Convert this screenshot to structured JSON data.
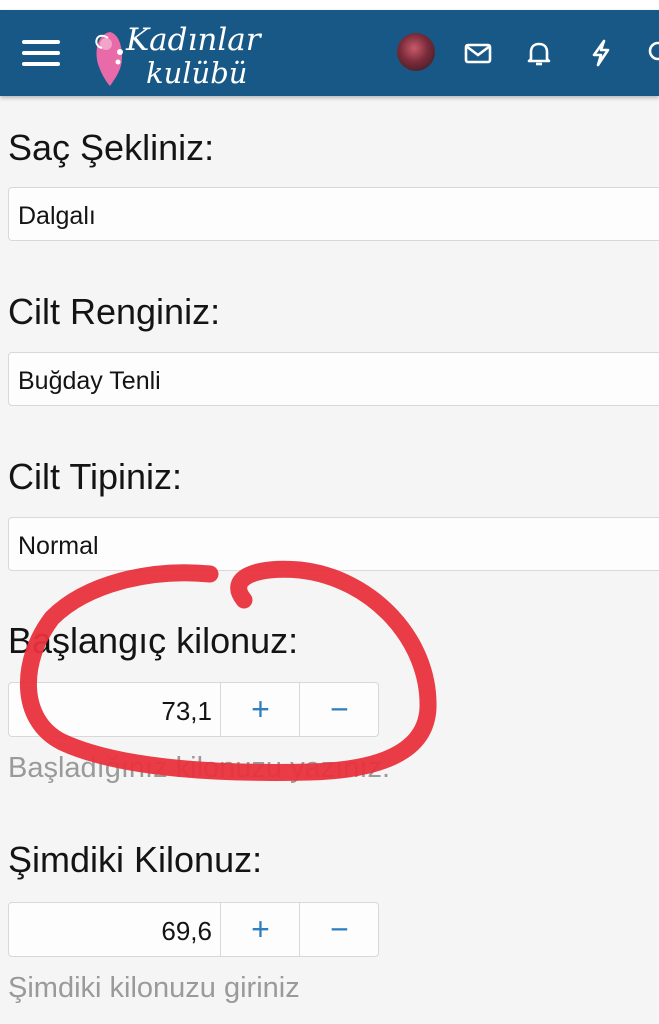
{
  "header": {
    "logo_line1": "Kadınlar",
    "logo_line2": "kulübü",
    "menu_icon": "hamburger-menu-icon",
    "icons": [
      "envelope-icon",
      "bell-icon",
      "lightning-icon",
      "search-icon"
    ],
    "bg_color": "#185886"
  },
  "fields": {
    "hair": {
      "label": "Saç Şekliniz:",
      "value": "Dalgalı"
    },
    "skin_color": {
      "label": "Cilt Renginiz:",
      "value": "Buğday Tenli"
    },
    "skin_type": {
      "label": "Cilt Tipiniz:",
      "value": "Normal"
    },
    "start_weight": {
      "label": "Başlangıç kilonuz:",
      "value": "73,1",
      "plus": "+",
      "minus": "−",
      "hint": "Başladığınız kilonuzu yazınız."
    },
    "current_weight": {
      "label": "Şimdiki Kilonuz:",
      "value": "69,6",
      "plus": "+",
      "minus": "−",
      "hint": "Şimdiki kilonuzu giriniz"
    }
  },
  "annotation": {
    "type": "hand-drawn-circle",
    "color": "#e8323c"
  },
  "accent_color": "#2f7fbe"
}
